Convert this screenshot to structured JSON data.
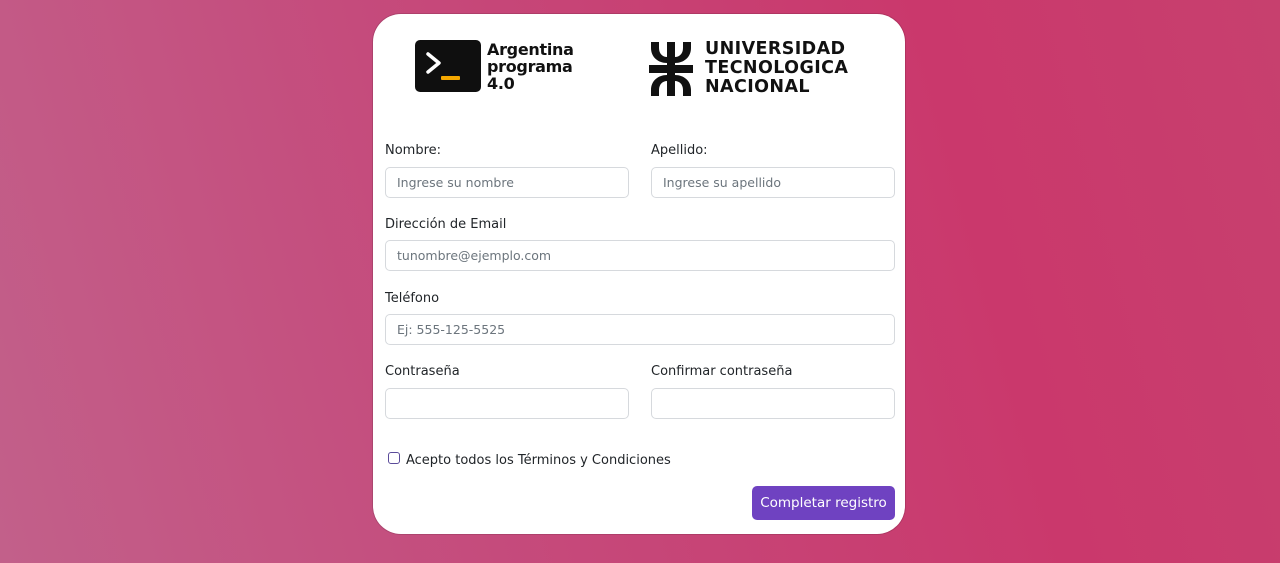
{
  "logos": {
    "argentina_programa": {
      "lines": [
        "Argentina",
        "programa",
        "4.0"
      ]
    },
    "utn": {
      "lines": [
        "UNIVERSIDAD",
        "TECNOLOGICA",
        "NACIONAL"
      ]
    }
  },
  "form": {
    "nombre": {
      "label": "Nombre:",
      "placeholder": "Ingrese su nombre",
      "value": ""
    },
    "apellido": {
      "label": "Apellido:",
      "placeholder": "Ingrese su apellido",
      "value": ""
    },
    "email": {
      "label": "Dirección de Email",
      "placeholder": "tunombre@ejemplo.com",
      "value": ""
    },
    "telefono": {
      "label": "Teléfono",
      "placeholder": "Ej: 555-125-5525",
      "value": ""
    },
    "contrasena": {
      "label": "Contraseña",
      "placeholder": "",
      "value": ""
    },
    "confirmar": {
      "label": "Confirmar contraseña",
      "placeholder": "",
      "value": ""
    },
    "terms": {
      "label": "Acepto todos los Términos y Condiciones",
      "checked": false
    },
    "submit_label": "Completar registro"
  },
  "colors": {
    "background_from": "#c2608a",
    "background_to": "#ca386c",
    "button": "#6f42c1",
    "card": "#ffffff"
  }
}
